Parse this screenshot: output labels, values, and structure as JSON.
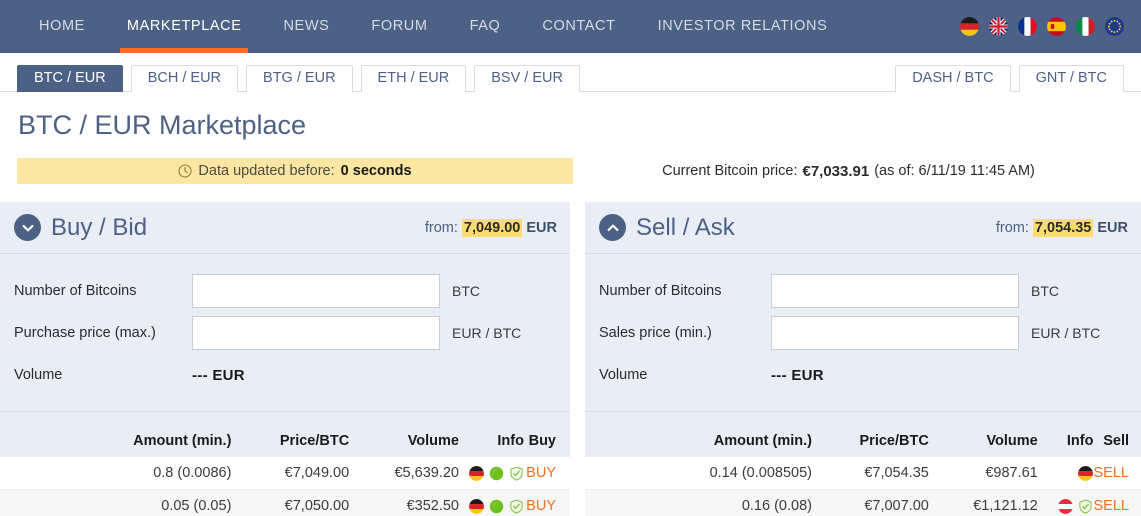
{
  "nav": {
    "items": [
      {
        "label": "HOME",
        "active": false
      },
      {
        "label": "MARKETPLACE",
        "active": true
      },
      {
        "label": "NEWS",
        "active": false
      },
      {
        "label": "FORUM",
        "active": false
      },
      {
        "label": "FAQ",
        "active": false
      },
      {
        "label": "CONTACT",
        "active": false
      },
      {
        "label": "INVESTOR RELATIONS",
        "active": false
      }
    ],
    "flags": [
      "de",
      "gb",
      "fr",
      "es",
      "it",
      "eu"
    ]
  },
  "tabs": {
    "left": [
      {
        "label": "BTC / EUR",
        "active": true
      },
      {
        "label": "BCH / EUR",
        "active": false
      },
      {
        "label": "BTG / EUR",
        "active": false
      },
      {
        "label": "ETH / EUR",
        "active": false
      },
      {
        "label": "BSV / EUR",
        "active": false
      }
    ],
    "right": [
      {
        "label": "DASH / BTC",
        "active": false
      },
      {
        "label": "GNT / BTC",
        "active": false
      }
    ]
  },
  "page": {
    "title": "BTC / EUR Marketplace"
  },
  "status": {
    "updated_label": "Data updated before:",
    "updated_value": "0 seconds",
    "price_label": "Current Bitcoin price:",
    "price_value": "€7,033.91",
    "price_asof": "(as of: 6/11/19 11:45 AM)"
  },
  "buy_panel": {
    "title": "Buy / Bid",
    "from_label": "from:",
    "from_value": "7,049.00",
    "from_currency": "EUR",
    "toggle_icon": "chevron-down-icon",
    "form": {
      "amount_label": "Number of Bitcoins",
      "amount_value": "",
      "amount_unit": "BTC",
      "price_label": "Purchase price (max.)",
      "price_value": "",
      "price_unit": "EUR / BTC",
      "volume_label": "Volume",
      "volume_value": "--- EUR"
    },
    "table": {
      "headers": [
        "Amount (min.)",
        "Price/BTC",
        "Volume",
        "Info",
        "Buy"
      ],
      "rows": [
        {
          "amount": "0.8 (0.0086)",
          "price": "€7,049.00",
          "volume": "€5,639.20",
          "icons": [
            "flag-de-icon",
            "green-badge-icon",
            "shield-check-icon"
          ],
          "action": "BUY"
        },
        {
          "amount": "0.05 (0.05)",
          "price": "€7,050.00",
          "volume": "€352.50",
          "icons": [
            "flag-de-icon",
            "green-badge-icon",
            "shield-check-icon"
          ],
          "action": "BUY"
        }
      ]
    }
  },
  "sell_panel": {
    "title": "Sell / Ask",
    "from_label": "from:",
    "from_value": "7,054.35",
    "from_currency": "EUR",
    "toggle_icon": "chevron-up-icon",
    "form": {
      "amount_label": "Number of Bitcoins",
      "amount_value": "",
      "amount_unit": "BTC",
      "price_label": "Sales price (min.)",
      "price_value": "",
      "price_unit": "EUR / BTC",
      "volume_label": "Volume",
      "volume_value": "--- EUR"
    },
    "table": {
      "headers": [
        "Amount (min.)",
        "Price/BTC",
        "Volume",
        "Info",
        "Sell"
      ],
      "rows": [
        {
          "amount": "0.14 (0.008505)",
          "price": "€7,054.35",
          "volume": "€987.61",
          "icons": [
            "flag-de-icon"
          ],
          "action": "SELL"
        },
        {
          "amount": "0.16 (0.08)",
          "price": "€7,007.00",
          "volume": "€1,121.12",
          "icons": [
            "flag-at-icon",
            "shield-check-icon"
          ],
          "action": "SELL"
        }
      ]
    }
  },
  "colors": {
    "navbar": "#4c6185",
    "accent_orange": "#ee7220",
    "panel_bg": "#e8edf6",
    "highlight_yellow": "#fbdd6f",
    "banner_yellow": "#fbe7a2"
  }
}
